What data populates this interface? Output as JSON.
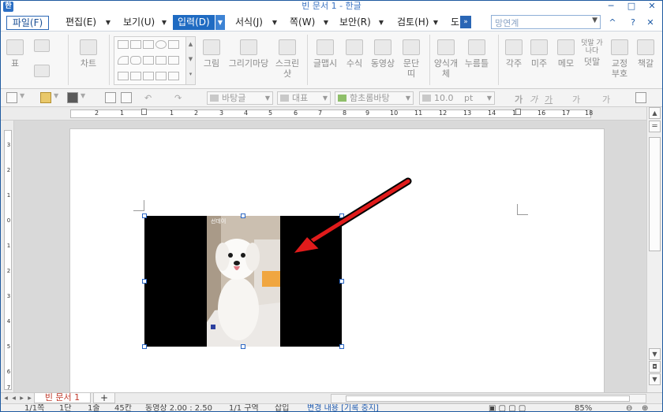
{
  "window": {
    "title": "빈 문서 1 - 한글",
    "app_icon": "hwp-logo-icon",
    "minimize": "─",
    "maximize": "□",
    "close": "✕"
  },
  "menubar": {
    "file": "파일(F)",
    "items": [
      "편집(E)",
      "보기(U)",
      "입력(D)",
      "서식(J)",
      "쪽(W)",
      "보안(R)",
      "검토(H)",
      "도"
    ],
    "active_item": "입력(D)",
    "more": "»",
    "search_placeholder": "망연계",
    "help": "?",
    "collapse": "^"
  },
  "ribbon": {
    "table": "표",
    "chart": "차트",
    "picture": "그림",
    "drawing": "그리기마당",
    "screenshot": "스크린샷",
    "textart": "글맵시",
    "equation": "수식",
    "video": "동영상",
    "paragraph": "문단띠",
    "form_object": "양식개체",
    "button": "누름틀",
    "footnote": "각주",
    "endnote": "미주",
    "memo": "메모",
    "comment": "덧말",
    "comment_top": "덧말 가나다",
    "proof_mark": "교정부호",
    "bookmark": "책갈"
  },
  "toolbar": {
    "style": "바탕글",
    "font_type": "대표",
    "font_name": "함초롬바탕",
    "font_size": "10.0",
    "unit": "pt",
    "bold": "가",
    "italic": "가",
    "underline": "가",
    "strike": "가"
  },
  "ruler": {
    "ticks": [
      "2",
      "1",
      "1",
      "2",
      "3",
      "4",
      "5",
      "6",
      "7",
      "8",
      "9",
      "10",
      "11",
      "12",
      "13",
      "14",
      "15",
      "16",
      "17",
      "18"
    ]
  },
  "vruler": {
    "ticks": [
      "3",
      "2",
      "1",
      "0",
      "1",
      "2",
      "3",
      "4",
      "5",
      "6",
      "7"
    ]
  },
  "document": {
    "image_watermark": "선데이"
  },
  "tabs": {
    "doc_tab": "빈 문서 1",
    "add": "+"
  },
  "status": {
    "page": "1/1쪽",
    "section": "1단",
    "line": "1줄",
    "column": "45칸",
    "object": "동영상 2.00 : 2.50",
    "section_info": "1/1 구역",
    "insert": "삽입",
    "track_changes": "변경 내용 [기록 중지]",
    "zoom": "85%"
  }
}
